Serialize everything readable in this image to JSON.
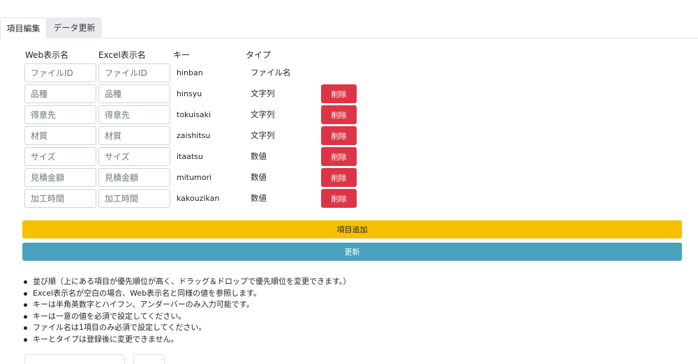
{
  "tabs": [
    {
      "label": "項目編集",
      "active": true
    },
    {
      "label": "データ更新",
      "active": false
    }
  ],
  "headers": {
    "web_name": "Web表示名",
    "excel_name": "Excel表示名",
    "key": "キー",
    "type": "タイプ"
  },
  "rows": [
    {
      "web_placeholder": "ファイルID",
      "excel_placeholder": "ファイルID",
      "key": "hinban",
      "type": "ファイル名",
      "deletable": false
    },
    {
      "web_placeholder": "品種",
      "excel_placeholder": "品種",
      "key": "hinsyu",
      "type": "文字列",
      "deletable": true
    },
    {
      "web_placeholder": "得意先",
      "excel_placeholder": "得意先",
      "key": "tokuisaki",
      "type": "文字列",
      "deletable": true
    },
    {
      "web_placeholder": "材質",
      "excel_placeholder": "材質",
      "key": "zaishitsu",
      "type": "文字列",
      "deletable": true
    },
    {
      "web_placeholder": "サイズ",
      "excel_placeholder": "サイズ",
      "key": "itaatsu",
      "type": "数値",
      "deletable": true
    },
    {
      "web_placeholder": "見積金額",
      "excel_placeholder": "見積金額",
      "key": "mitumori",
      "type": "数値",
      "deletable": true
    },
    {
      "web_placeholder": "加工時間",
      "excel_placeholder": "加工時間",
      "key": "kakouzikan",
      "type": "数値",
      "deletable": true
    }
  ],
  "delete_label": "削除",
  "add_label": "項目追加",
  "update_label": "更新",
  "notes": [
    "並び順（上にある項目が優先順位が高く、ドラッグ＆ドロップで優先順位を変更できます。）",
    "Excel表示名が空白の場合、Web表示名と同様の値を参照します。",
    "キーは半角英数字とハイフン、アンダーバーのみ入力可能です。",
    "キーは一意の値を必須で設定してください。",
    "ファイル名は1項目のみ必須で設定してください。",
    "キーとタイプは登録後に変更できません。"
  ],
  "colors": {
    "delete": "#dc3545",
    "add": "#f6c000",
    "update": "#4aa2bd",
    "tab_inactive": "#e9ecef"
  }
}
